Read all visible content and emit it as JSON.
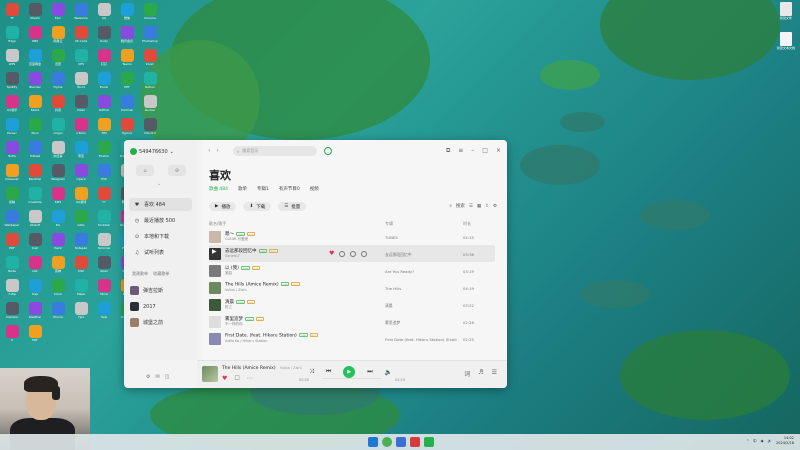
{
  "desktop": {
    "icons": [
      "TF",
      "Steam",
      "Epic",
      "WeGame",
      "QQ",
      "微信",
      "Chrome",
      "Edge",
      "OBS",
      "网易云",
      "VS Code",
      "Unity",
      "腾讯会议",
      "Photoshop",
      "WPS",
      "百度网盘",
      "迅雷",
      "UE5",
      "钉钉",
      "Teams",
      "Zoom",
      "Spotify",
      "Blender",
      "Figma",
      "Word",
      "Excel",
      "PPT",
      "Notion",
      "QQ音乐",
      "Bilibili",
      "抖音",
      "Clash",
      "GitHub",
      "Postman",
      "Docker",
      "Parsec",
      "Xbox",
      "Origin",
      "uTools",
      "TIM",
      "Typora",
      "Discord",
      "MuMu",
      "ToDesk",
      "向日葵",
      "夸克",
      "Firefox",
      "PotPlayer",
      "Everything",
      "CCleaner",
      "Bandizip",
      "Telegram",
      "Opera",
      "PS5",
      "Pr",
      "Ae",
      "剪映",
      "OneNote",
      "KMS",
      "QQ游戏",
      "YY",
      "网易UU",
      "Battle.net",
      "Wallpaper",
      "Ubisoft",
      "EA",
      "GOG",
      "Rockstar",
      "OneDrive",
      "Mail",
      "PDF",
      "Calc",
      "Paint",
      "Notepad",
      "Terminal",
      "Python",
      "Java",
      "Node",
      "LOL",
      "原神",
      "CS2",
      "Apex",
      "Dota2",
      "PUBG",
      "7-Zip",
      "Snip",
      "Clock",
      "Maps",
      "Store",
      "Music",
      "Photos",
      "Camera",
      "Weather",
      "Phone",
      "Tips",
      "Help",
      "Cortana",
      "Office",
      "P",
      "PDF"
    ],
    "right_icons": [
      {
        "label": "新建文件"
      },
      {
        "label": "新建文本文档"
      }
    ]
  },
  "app": {
    "account": "549476630",
    "sidebar": {
      "items": [
        {
          "label": "喜欢 484",
          "icon": "heart"
        },
        {
          "label": "最近播放 500",
          "icon": "clock"
        },
        {
          "label": "本地和下载",
          "icon": "download"
        },
        {
          "label": "试听列表",
          "icon": "headphone"
        }
      ],
      "section_label": "我建歌单",
      "section_sub": "收藏歌单",
      "playlists": [
        {
          "label": "弹吉拉斯"
        },
        {
          "label": "2017"
        },
        {
          "label": "城堡之前"
        }
      ]
    },
    "search_placeholder": "搜索音乐",
    "page_title": "喜欢",
    "tabs": [
      "歌曲 484",
      "歌单",
      "专辑1",
      "有声节目0",
      "视频"
    ],
    "actions": {
      "play": "播放",
      "download": "下载",
      "batch": "批量"
    },
    "tool_search": "搜索",
    "table_headers": {
      "title": "歌名/歌手",
      "album": "专辑",
      "duration": "时长"
    },
    "songs": [
      {
        "title": "嗯～",
        "artist": "CLEAR 可爱妮",
        "album": "TUNES",
        "duration": "04:15",
        "color": "#c9b8a8"
      },
      {
        "title": "去远那段回忆中",
        "artist": "Sanelk-T",
        "album": "去远那段回忆中",
        "duration": "03:36",
        "color": "#333333"
      },
      {
        "title": "以 (我)",
        "artist": "某曲",
        "album": "Are You Ready?",
        "duration": "03:19",
        "color": "#7a7a7a"
      },
      {
        "title": "The Hills (Amice Remix)",
        "artist": "Vuiba / Zishi",
        "album": "The Hills",
        "duration": "04:19",
        "color": "#6d8a5c"
      },
      {
        "title": "清晨",
        "artist": "陈之",
        "album": "清晨",
        "duration": "03:22",
        "color": "#3a5a3a"
      },
      {
        "title": "雾里追梦",
        "artist": "不一样的你",
        "album": "雾里追梦",
        "duration": "02:26",
        "color": "#dddddd"
      },
      {
        "title": "First Date. (feat. Hikaru Station)",
        "artist": "Adlib Ko / Hikaru Station",
        "album": "First Date (feat. Hikaru Station) (Explicit)",
        "duration": "02:25",
        "color": "#8a8ab0"
      }
    ],
    "player": {
      "title": "The Hills (Amice Remix)",
      "artist": "Vuiba / Zishi",
      "elapsed": "00:00",
      "total": "04:19",
      "progress": 0.0
    }
  },
  "taskbar": {
    "time": "14:02",
    "date": "2024/2/18",
    "lang": "中"
  }
}
